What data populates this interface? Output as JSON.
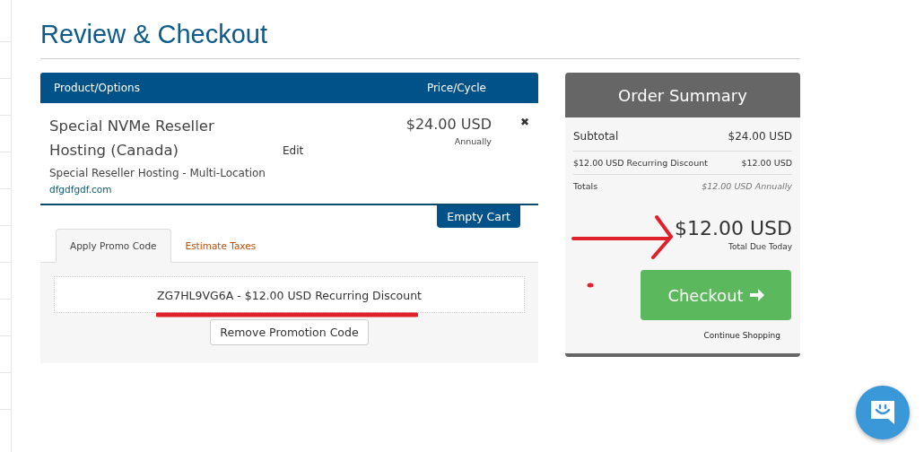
{
  "page_title": "Review & Checkout",
  "cart": {
    "columns": [
      "Product/Options",
      "Price/Cycle"
    ],
    "items": [
      {
        "name": "Special NVMe Reseller Hosting (Canada)",
        "edit": "Edit",
        "group": "Special Reseller Hosting - Multi-Location",
        "domain": "dfgdfgdf.com",
        "price": "$24.00 USD",
        "cycle": "Annually",
        "remove": "✖"
      }
    ],
    "empty_cart": "Empty Cart"
  },
  "tabs": [
    {
      "label": "Apply Promo Code",
      "selected": true
    },
    {
      "label": "Estimate Taxes",
      "selected": false
    }
  ],
  "promo": {
    "applied": "ZG7HL9VG6A - $12.00 USD Recurring Discount",
    "remove_button": "Remove Promotion Code"
  },
  "summary": {
    "title": "Order Summary",
    "rows": [
      {
        "label": "Subtotal",
        "value": "$24.00 USD",
        "kind": "main"
      },
      {
        "label": "$12.00 USD Recurring Discount",
        "value": "$12.00 USD",
        "kind": "small"
      },
      {
        "label": "Totals",
        "value": "$12.00 USD Annually",
        "kind": "totals"
      }
    ],
    "total": "$12.00 USD",
    "total_label": "Total Due Today",
    "checkout": "Checkout",
    "continue": "Continue Shopping"
  }
}
